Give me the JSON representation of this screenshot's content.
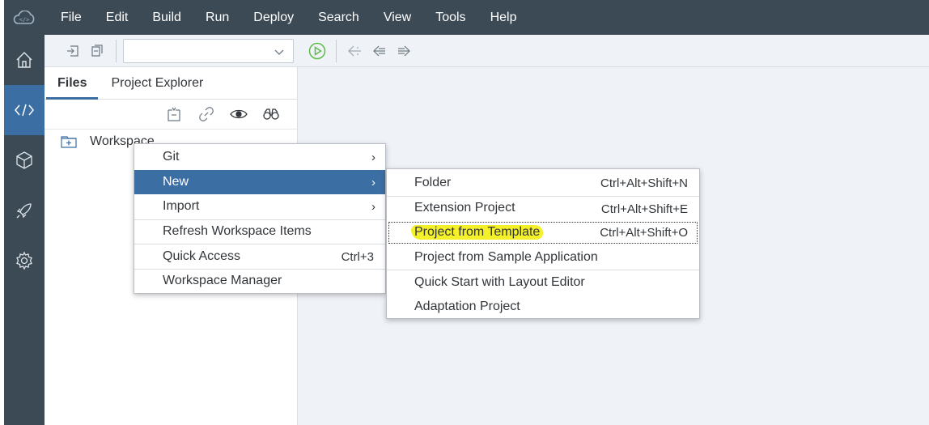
{
  "menubar": {
    "items": [
      "File",
      "Edit",
      "Build",
      "Run",
      "Deploy",
      "Search",
      "View",
      "Tools",
      "Help"
    ]
  },
  "rail": {
    "items": [
      {
        "icon": "home-icon"
      },
      {
        "icon": "code-icon",
        "active": true
      },
      {
        "icon": "cube-icon"
      },
      {
        "icon": "rocket-icon"
      },
      {
        "icon": "gear-icon"
      }
    ]
  },
  "toolbar": {
    "select_value": ""
  },
  "panel": {
    "tabs": [
      "Files",
      "Project Explorer"
    ],
    "tree": {
      "workspace_label": "Workspace"
    }
  },
  "context_menu": {
    "items": [
      "Git",
      "New",
      "Import",
      "Refresh Workspace Items",
      "Quick Access",
      "Workspace Manager"
    ],
    "quick_access_shortcut": "Ctrl+3"
  },
  "submenu_new": {
    "items": [
      {
        "label": "Folder",
        "shortcut": "Ctrl+Alt+Shift+N"
      },
      {
        "label": "Extension Project",
        "shortcut": "Ctrl+Alt+Shift+E"
      },
      {
        "label": "Project from Template",
        "shortcut": "Ctrl+Alt+Shift+O"
      },
      {
        "label": "Project from Sample Application",
        "shortcut": ""
      },
      {
        "label": "Quick Start with Layout Editor",
        "shortcut": ""
      },
      {
        "label": "Adaptation Project",
        "shortcut": ""
      }
    ]
  },
  "colors": {
    "shell": "#3c4a55",
    "accent": "#3b6ea3",
    "highlight": "#f4f02a",
    "run_icon": "#5fbb46"
  }
}
